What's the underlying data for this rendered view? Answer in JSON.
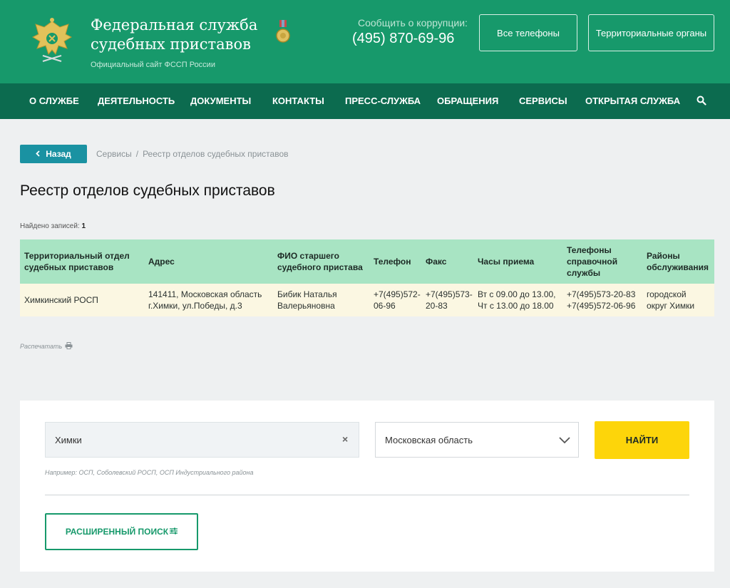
{
  "header": {
    "title_line1": "Федеральная служба",
    "title_line2": "судебных приставов",
    "subtitle": "Официальный сайт ФССП России",
    "corruption_label": "Сообщить о коррупции:",
    "corruption_phone": "(495) 870-69-96",
    "all_phones_label": "Все телефоны",
    "territorial_label": "Территориальные органы"
  },
  "nav": {
    "items": [
      "О СЛУЖБЕ",
      "ДЕЯТЕЛЬНОСТЬ",
      "ДОКУМЕНТЫ",
      "КОНТАКТЫ",
      "ПРЕСС-СЛУЖБА",
      "ОБРАЩЕНИЯ",
      "СЕРВИСЫ",
      "ОТКРЫТАЯ СЛУЖБА"
    ],
    "search_icon": "search-icon"
  },
  "breadcrumb": {
    "back_label": "Назад",
    "items": [
      "Сервисы",
      "Реестр отделов судебных приставов"
    ]
  },
  "page": {
    "title": "Реестр отделов судебных приставов",
    "found_label": "Найдено записей:",
    "found_count": "1"
  },
  "table": {
    "headers": [
      "Территориальный отдел судебных приставов",
      "Адрес",
      "ФИО старшего судебного пристава",
      "Телефон",
      "Факс",
      "Часы приема",
      "Телефоны справочной службы",
      "Районы обслуживания"
    ],
    "rows": [
      {
        "office": "Химкинский РОСП",
        "address_line1": "141411, Московская область",
        "address_line2": "г.Химки, ул.Победы, д.3",
        "chief_line1": "Бибик Наталья",
        "chief_line2": "Валерьяновна",
        "phone_line1": "+7(495)572-",
        "phone_line2": "06-96",
        "fax_line1": "+7(495)573-",
        "fax_line2": "20-83",
        "hours_line1": "Вт с 09.00 до 13.00,",
        "hours_line2": "Чт с 13.00 до 18.00",
        "info_line1": "+7(495)573-20-83",
        "info_line2": "+7(495)572-06-96",
        "district_line1": "городской",
        "district_line2": "округ Химки"
      }
    ]
  },
  "print_label": "Распечатать",
  "search": {
    "query_value": "Химки",
    "region_value": "Московская область",
    "find_label": "НАЙТИ",
    "example": "Например: ОСП, Соболевский РОСП, ОСП Индустриального района",
    "advanced_label": "РАСШИРЕННЫЙ ПОИСК"
  },
  "colors": {
    "header_green": "#17996b",
    "nav_green": "#0c6b4f",
    "table_header": "#a8e4c3",
    "row_bg": "#fbf7e2",
    "find_yellow": "#fdd50a",
    "back_teal": "#1a92a2"
  }
}
